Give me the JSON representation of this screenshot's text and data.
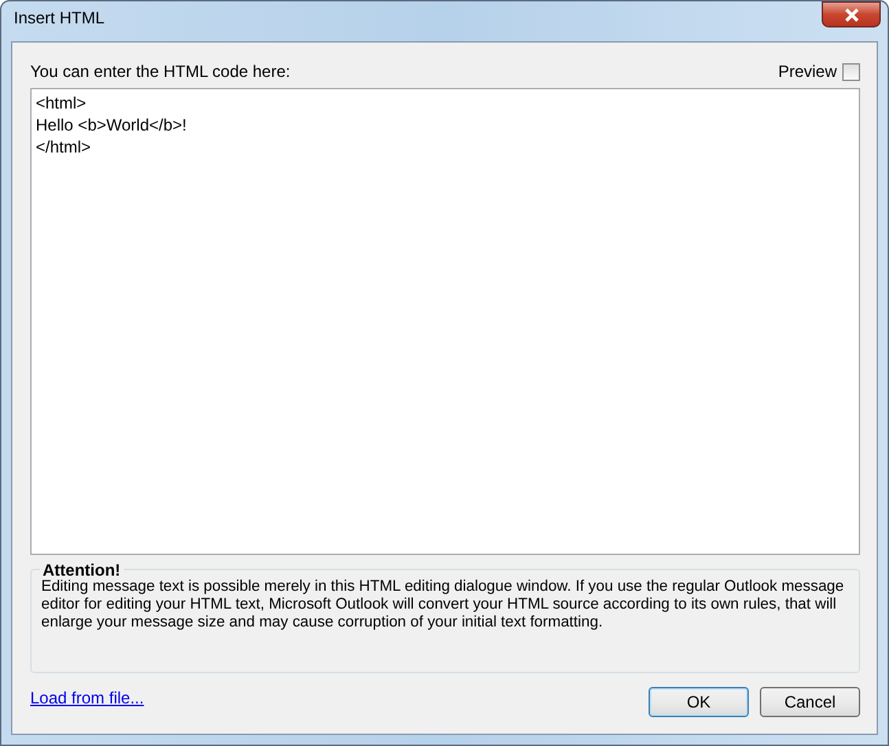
{
  "window": {
    "title": "Insert HTML"
  },
  "editor": {
    "label": "You can enter the HTML code here:",
    "value": "<html>\nHello <b>World</b>!\n</html>"
  },
  "preview": {
    "label": "Preview",
    "checked": false
  },
  "attention": {
    "title": "Attention!",
    "text": "Editing message text is possible merely in this HTML editing dialogue window. If you use the regular Outlook message editor for editing your HTML text, Microsoft Outlook will convert your HTML source according to its own rules, that will enlarge your message size and may cause corruption of your initial text formatting."
  },
  "link": "Load from file...",
  "buttons": [
    {
      "label": "OK",
      "default": true
    },
    {
      "label": "Cancel",
      "default": false
    }
  ]
}
